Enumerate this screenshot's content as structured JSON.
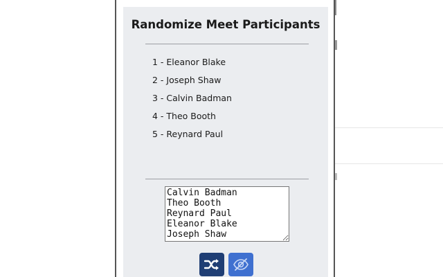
{
  "popup": {
    "title": "Randomize Meet Participants",
    "participants": [
      "1 - Eleanor Blake",
      "2 - Joseph Shaw",
      "3 - Calvin Badman",
      "4 - Theo Booth",
      "5 - Reynard Paul"
    ],
    "names_input": {
      "value": "Calvin Badman\nTheo Booth\nReynard Paul\nEleanor Blake\nJoseph Shaw"
    },
    "buttons": {
      "shuffle_icon": "shuffle-icon",
      "hide_icon": "eye-slash-icon"
    },
    "colors": {
      "panel_bg": "#ebedf0",
      "shuffle_button": "#1f3e74",
      "hide_button": "#3f70d0"
    }
  }
}
